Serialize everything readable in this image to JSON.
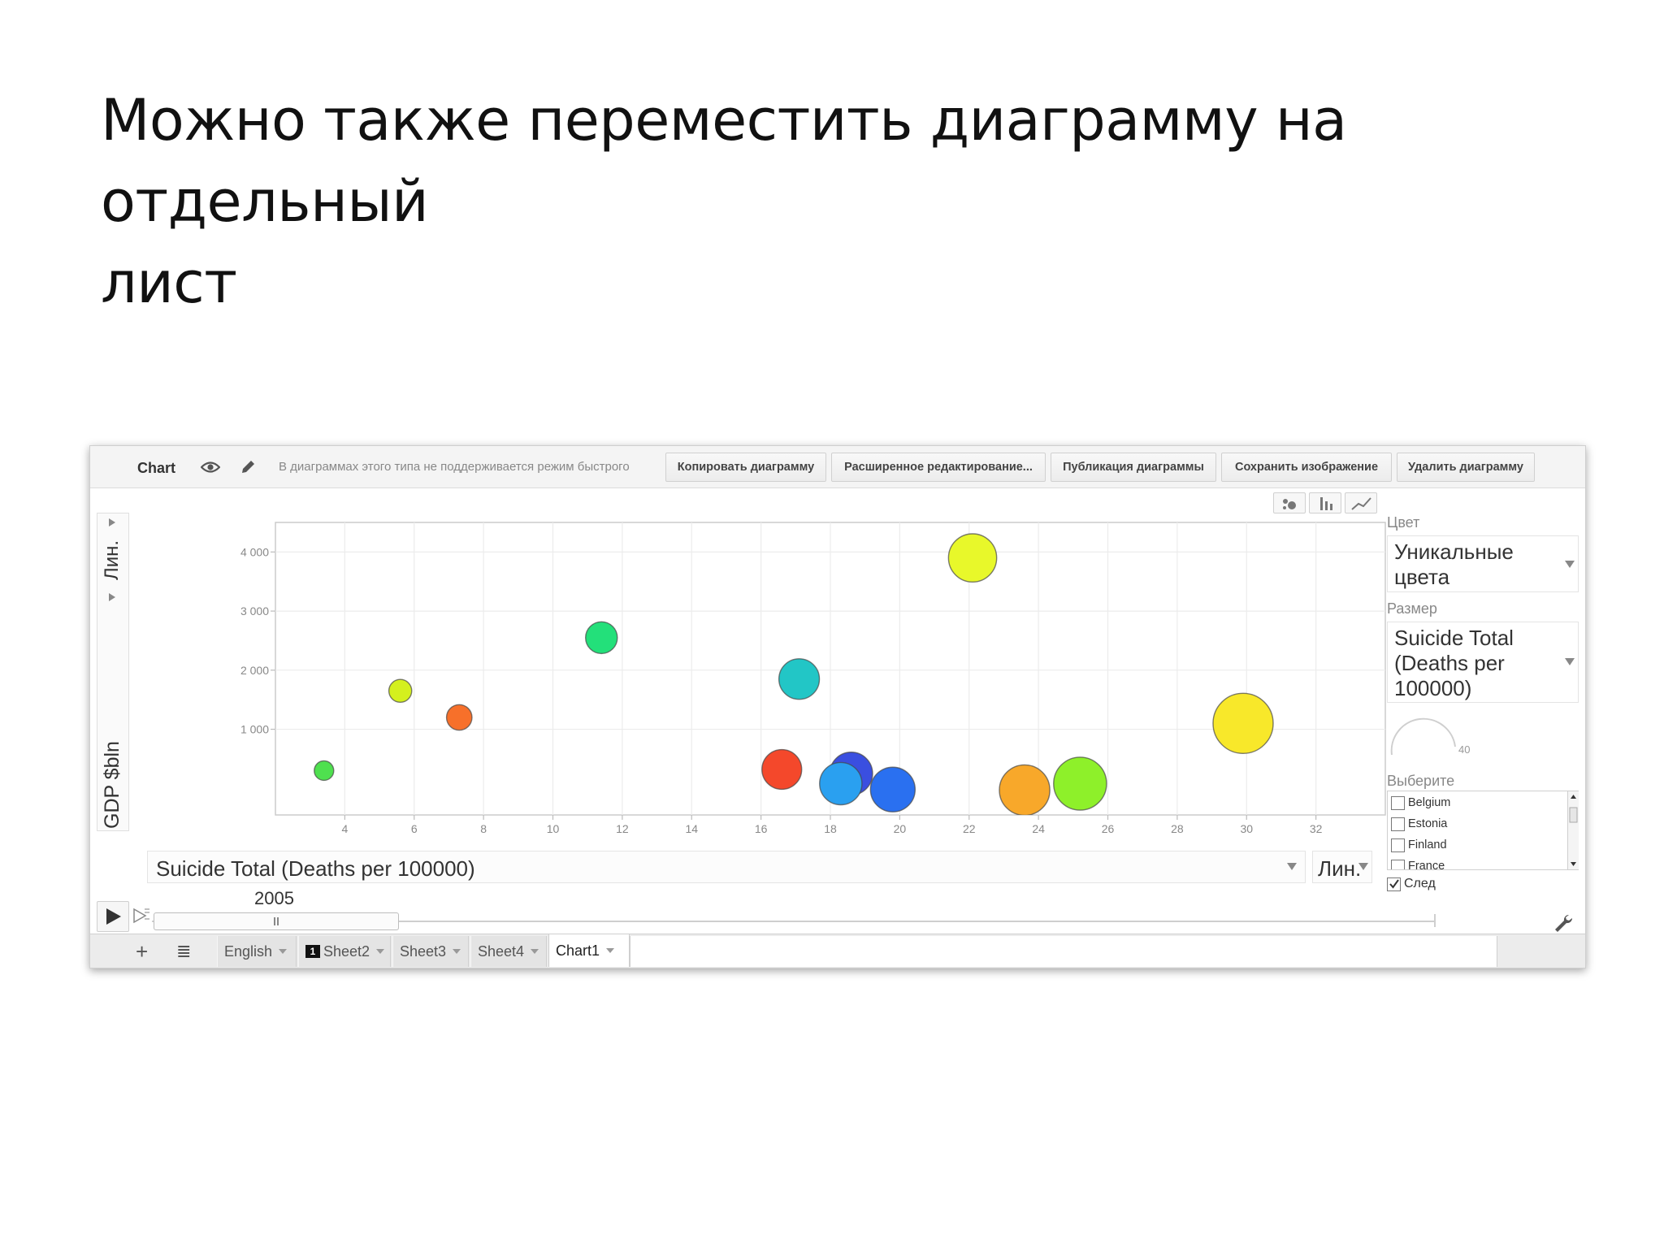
{
  "slide": {
    "title_line1": "Можно также переместить диаграмму на отдельный",
    "title_line2": "лист"
  },
  "toolbar": {
    "chart_label": "Chart",
    "notice": "В диаграммах этого типа не поддерживается режим быстрого",
    "buttons": [
      "Копировать диаграмму",
      "Расширенное редактирование...",
      "Публикация диаграммы",
      "Сохранить изображение",
      "Удалить диаграмму"
    ],
    "icons": [
      "eye-icon",
      "pencil-icon"
    ]
  },
  "chart_types": [
    "bubble-chart-icon",
    "bar-chart-icon",
    "line-chart-icon"
  ],
  "y_axis": {
    "scale_label": "Лин.",
    "selected_label": "GDP $bln"
  },
  "x_axis": {
    "selected_label": "Suicide Total (Deaths per 100000)",
    "scale_label": "Лин."
  },
  "playback": {
    "year": "2005"
  },
  "panel": {
    "color_label": "Цвет",
    "color_value": "Уникальные цвета",
    "size_label": "Размер",
    "size_value": "Suicide Total (Deaths per 100000)",
    "size_gauge_value": "40",
    "select_label": "Выберите",
    "countries": [
      "Belgium",
      "Estonia",
      "Finland",
      "France"
    ],
    "trails_label": "След",
    "trails_checked": true
  },
  "sheets": {
    "tabs": [
      {
        "label": "English",
        "active": false
      },
      {
        "label": "Sheet2",
        "active": false,
        "badge": "1"
      },
      {
        "label": "Sheet3",
        "active": false
      },
      {
        "label": "Sheet4",
        "active": false
      },
      {
        "label": "Chart1",
        "active": true
      }
    ]
  },
  "chart_data": {
    "type": "scatter",
    "title": "",
    "xlabel": "Suicide Total (Deaths per 100000)",
    "ylabel": "GDP $bln",
    "xlim": [
      2,
      34
    ],
    "ylim": [
      -450,
      4500
    ],
    "x_ticks": [
      4,
      6,
      8,
      10,
      12,
      14,
      16,
      18,
      20,
      22,
      24,
      26,
      28,
      30,
      32
    ],
    "y_ticks": [
      1000,
      2000,
      3000,
      4000
    ],
    "y_tick_labels": [
      "1 000",
      "2 000",
      "3 000",
      "4 000"
    ],
    "grid": true,
    "points": [
      {
        "x": 3.4,
        "y": 300,
        "size": 3.4,
        "color": "#4fe04f"
      },
      {
        "x": 5.6,
        "y": 1650,
        "size": 5.6,
        "color": "#d4f01e"
      },
      {
        "x": 7.3,
        "y": 1200,
        "size": 7.3,
        "color": "#f7702a"
      },
      {
        "x": 11.4,
        "y": 2550,
        "size": 11.4,
        "color": "#23e07a"
      },
      {
        "x": 16.6,
        "y": 320,
        "size": 16.6,
        "color": "#f4482b"
      },
      {
        "x": 17.1,
        "y": 1850,
        "size": 17.1,
        "color": "#22c6c6"
      },
      {
        "x": 18.6,
        "y": 250,
        "size": 18.6,
        "color": "#3a4fe0"
      },
      {
        "x": 18.3,
        "y": 80,
        "size": 18.3,
        "color": "#2aa0f0"
      },
      {
        "x": 19.8,
        "y": -20,
        "size": 19.8,
        "color": "#2a70f0"
      },
      {
        "x": 22.1,
        "y": 3900,
        "size": 22.1,
        "color": "#e8f82a"
      },
      {
        "x": 23.6,
        "y": -30,
        "size": 23.6,
        "color": "#f8a82a"
      },
      {
        "x": 25.2,
        "y": 80,
        "size": 25.2,
        "color": "#8ef02a"
      },
      {
        "x": 29.9,
        "y": 1100,
        "size": 29.9,
        "color": "#f8e82a"
      }
    ]
  }
}
